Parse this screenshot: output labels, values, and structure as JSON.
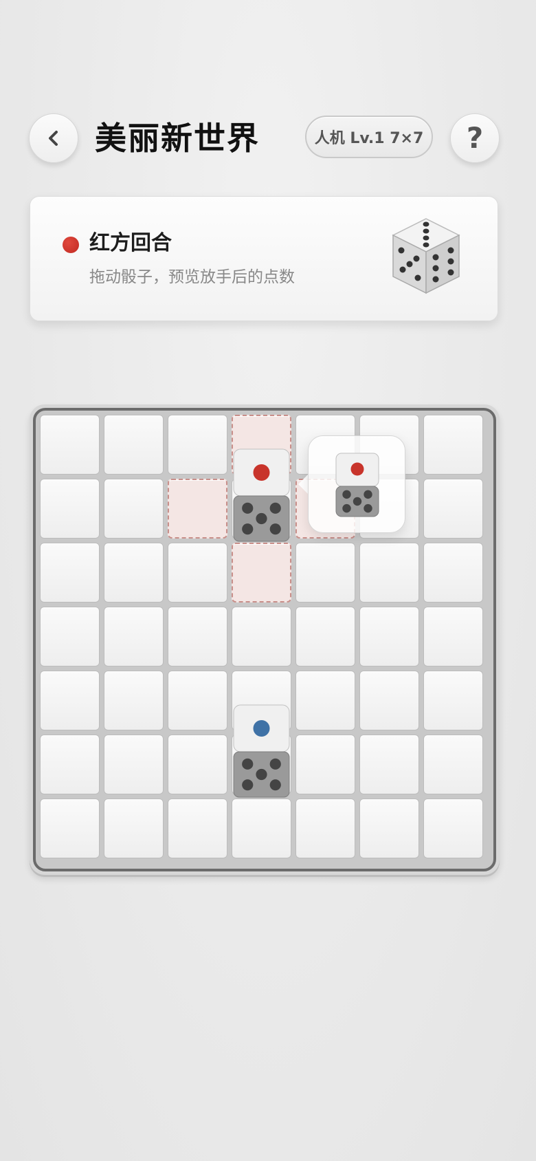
{
  "header": {
    "back_icon": "chevron-left-icon",
    "title": "美丽新世界",
    "mode": "人机 Lv.1 7×7",
    "help_label": "?"
  },
  "status": {
    "player_color": "#c8342b",
    "turn": "红方回合",
    "hint": "拖动骰子，预览放手后的点数",
    "dice_icon": "dice-icon"
  },
  "board": {
    "rows": 7,
    "cols": 7,
    "highlight_cells": [
      [
        0,
        3
      ],
      [
        1,
        2
      ],
      [
        1,
        4
      ],
      [
        2,
        3
      ]
    ],
    "pieces": [
      {
        "player": "red",
        "color": "#c8342b",
        "top_row": 0,
        "bottom_row": 1,
        "col": 3,
        "pips": 5
      },
      {
        "player": "blue",
        "color": "#3f72a6",
        "top_row": 4,
        "bottom_row": 5,
        "col": 3,
        "pips": 5
      }
    ],
    "drag_preview": {
      "player": "red",
      "color": "#c8342b",
      "pips": 5
    }
  }
}
